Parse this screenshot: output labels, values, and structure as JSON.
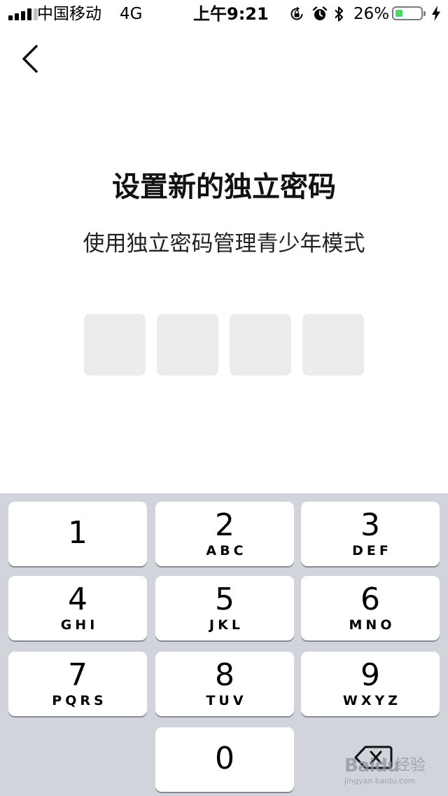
{
  "status_bar": {
    "carrier": "中国移动",
    "network": "4G",
    "time": "上午9:21",
    "battery_percent_label": "26%",
    "battery_level": 0.26,
    "battery_color": "#4cd964",
    "icons": [
      "signal-icon",
      "rotation-lock-icon",
      "alarm-icon",
      "bluetooth-icon",
      "battery-icon",
      "charging-icon"
    ]
  },
  "nav": {
    "back_icon": "chevron-left-icon"
  },
  "header": {
    "title": "设置新的独立密码",
    "subtitle": "使用独立密码管理青少年模式"
  },
  "pin": {
    "length": 4,
    "entered": 0,
    "box_color": "#ececec"
  },
  "keypad": {
    "keys": [
      {
        "digit": "1",
        "letters": ""
      },
      {
        "digit": "2",
        "letters": "ABC"
      },
      {
        "digit": "3",
        "letters": "DEF"
      },
      {
        "digit": "4",
        "letters": "GHI"
      },
      {
        "digit": "5",
        "letters": "JKL"
      },
      {
        "digit": "6",
        "letters": "MNO"
      },
      {
        "digit": "7",
        "letters": "PQRS"
      },
      {
        "digit": "8",
        "letters": "TUV"
      },
      {
        "digit": "9",
        "letters": "WXYZ"
      }
    ],
    "zero": "0",
    "delete_icon": "backspace-icon",
    "background_color": "#d1d4da"
  },
  "watermark": {
    "brand": "Baidu",
    "suffix": "经验",
    "url": "jingyan.baidu.com"
  }
}
